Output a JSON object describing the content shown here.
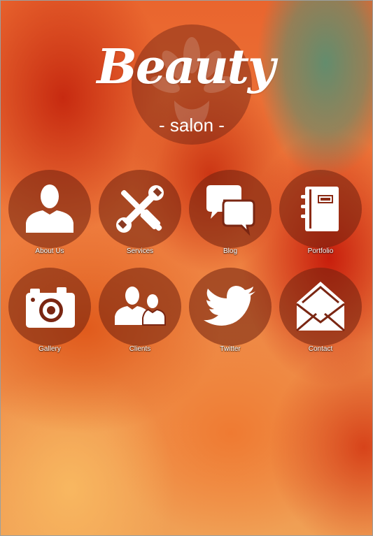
{
  "logo": {
    "title": "Beauty",
    "subtitle": "- salon -"
  },
  "tiles": [
    {
      "label": "About Us",
      "icon": "person-icon"
    },
    {
      "label": "Services",
      "icon": "tools-icon"
    },
    {
      "label": "Blog",
      "icon": "chat-bubbles-icon"
    },
    {
      "label": "Portfolio",
      "icon": "notebook-icon"
    },
    {
      "label": "Gallery",
      "icon": "camera-icon"
    },
    {
      "label": "Clients",
      "icon": "people-icon"
    },
    {
      "label": "Twitter",
      "icon": "twitter-bird-icon"
    },
    {
      "label": "Contact",
      "icon": "envelope-icon"
    }
  ],
  "colors": {
    "tile_circle": "#70200e",
    "text": "#ffffff",
    "accent_green": "#5c8e70"
  }
}
